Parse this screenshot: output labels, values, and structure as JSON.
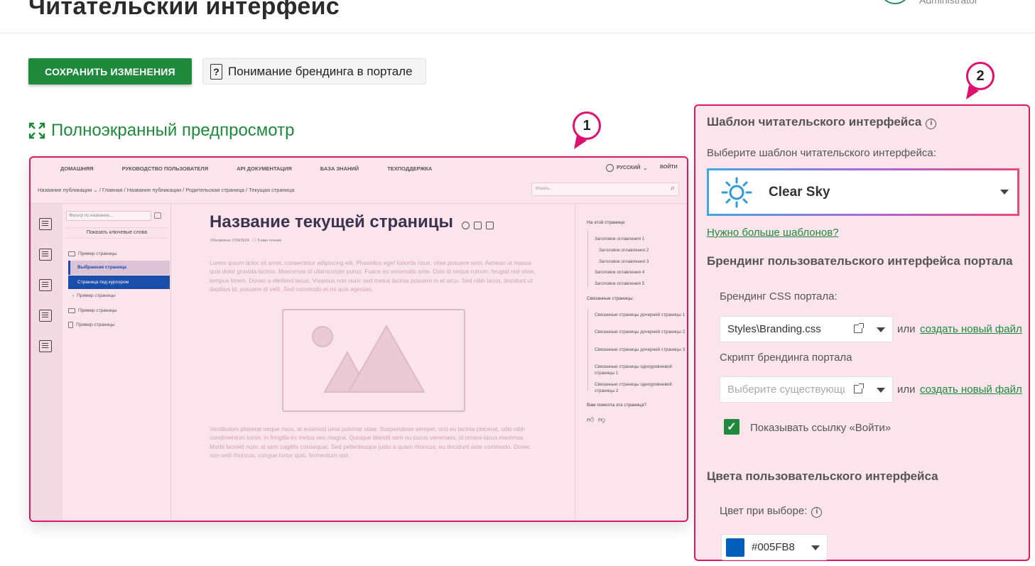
{
  "header": {
    "title": "Читательский интерфейс",
    "user_role": "Administrator"
  },
  "toolbar": {
    "save_label": "СОХРАНИТЬ ИЗМЕНЕНИЯ",
    "help_label": "Понимание брендинга в портале"
  },
  "preview": {
    "fullscreen_label": "Полноэкранный предпросмотр",
    "badge_number": "1",
    "nav": [
      "ДОМАШНЯЯ",
      "РУКОВОДСТВО ПОЛЬЗОВАТЕЛЯ",
      "API ДОКУМЕНТАЦИЯ",
      "БАЗА ЗНАНИЙ",
      "ТЕХПОДДЕРЖКА"
    ],
    "language": "РУССКИЙ",
    "login": "ВОЙТИ",
    "breadcrumbs": "Название публикации  ⌄   /  Главная  /  Название публикации  /  Родительская страница  /  Текущая страница",
    "search_placeholder": "Искать...",
    "tree": {
      "filter_placeholder": "Фильтр по названию...",
      "keywords_button": "Показать ключевые слова",
      "items": [
        "Пример страницы",
        "Выбранная страница",
        "Страница под курсором",
        "Пример страницы",
        "Пример страницы",
        "Пример страницы"
      ]
    },
    "page_title": "Название текущей страницы",
    "meta": "Обновлено 7/29/2024  ·  ⓘ 5 мин чтения",
    "paragraph1": "Lorem ipsum dolor sit amet, consectetur adipiscing elit. Phasellus eget lobortis risus, vitae posuere sem. Aenean ut massa quis dolor gravida lacinia. Maecenas id ullamcorper purus. Fusce eu venenatis ante. Duis id neque rutrum, feugiat nisl vitae, tempus lorem. Donec a eleifend lacus. Vivamus non nunc sed metus lacinia posuere in et arcu. Sed nibh lacus, tincidunt ut dapibus id, posuere id velit. Sed commodo et mi quis egestas.",
    "paragraph2": "Vestibulum placerat neque risus, at euismod urna pulvinar vitae. Suspendisse semper, orci eu lacinia placerat, odio nibh condimentum tortor, in fringilla ex metus nec magna. Quisque blandit sem eu purus venenatis, id ornare lacus maximus. Morbi laoreet nunc at sem sagittis consequat. Sed pellentesque justo a quam rhoncus, eu tincidunt ante commodo. Donec non velit rhoncus, congue tortor quis, fermentum nisl.",
    "toc": {
      "on_page_heading": "На этой странице:",
      "on_page": [
        "Заголовок оглавления 1",
        "Заголовок оглавления 2",
        "Заголовок оглавления 3",
        "Заголовок оглавления 4",
        "Заголовок оглавления 5"
      ],
      "related_heading": "Связанные страницы:",
      "related": [
        "Связанные страницы дочерней страницы 1",
        "Связанные страницы дочерней страницы 2",
        "Связанные страницы дочерней страницы 3",
        "Связанные страницы одноуровневой страницы 1",
        "Связанные страницы одноуровневой страницы 2"
      ],
      "feedback_question": "Вам помогла эта страница?"
    }
  },
  "panel": {
    "badge_number": "2",
    "template_heading": "Шаблон читательского интерфейса",
    "template_select_label": "Выберите шаблон читательского интерфейса:",
    "template_value": "Clear Sky",
    "more_templates_link": "Нужно больше шаблонов?",
    "branding_heading": "Брендинг пользовательского интерфейса портала",
    "css_label": "Брендинг CSS портала:",
    "css_value": "Styles\\Branding.css",
    "or_text": "или",
    "create_file_link": "создать новый файл",
    "script_label": "Скрипт брендинга портала",
    "script_placeholder": "Выберите существующий",
    "show_login_label": "Показывать ссылку «Войти»",
    "show_login_checked": true,
    "colors_heading": "Цвета пользовательского интерфейса",
    "selection_color_label": "Цвет при выборе:",
    "selection_color_value": "#005FB8"
  },
  "colors": {
    "accent_green": "#1f8a3c",
    "highlight_pink": "#d81b60",
    "selection_blue": "#005FB8"
  }
}
